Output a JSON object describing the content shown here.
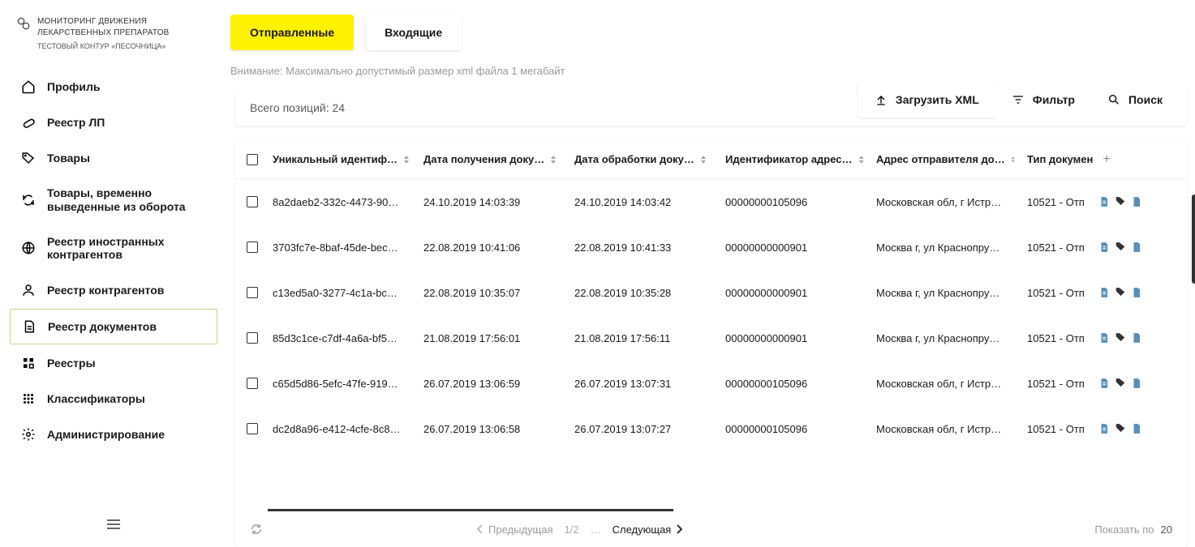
{
  "brand": {
    "title": "МОНИТОРИНГ ДВИЖЕНИЯ ЛЕКАРСТВЕННЫХ ПРЕПАРАТОВ",
    "subtitle": "ТЕСТОВЫЙ КОНТУР «ПЕСОЧНИЦА»"
  },
  "sidebar": {
    "items": [
      {
        "label": "Профиль"
      },
      {
        "label": "Реестр ЛП"
      },
      {
        "label": "Товары"
      },
      {
        "label": "Товары, временно выведенные из оборота"
      },
      {
        "label": "Реестр иностранных контрагентов"
      },
      {
        "label": "Реестр контрагентов"
      },
      {
        "label": "Реестр документов"
      },
      {
        "label": "Реестры"
      },
      {
        "label": "Классификаторы"
      },
      {
        "label": "Администрирование"
      }
    ]
  },
  "tabs": {
    "sent": "Отправленные",
    "incoming": "Входящие"
  },
  "warning": "Внимание: Максимально допустимый размер xml файла 1 мегабайт",
  "total_label": "Всего позиций: 24",
  "toolbar": {
    "upload": "Загрузить XML",
    "filter": "Фильтр",
    "search": "Поиск"
  },
  "columns": {
    "uid": "Уникальный идентиф…",
    "date_received": "Дата получения доку…",
    "date_processed": "Дата обработки доку…",
    "address_id": "Идентификатор адрес…",
    "sender_addr": "Адрес отправителя до…",
    "doc_type": "Тип докумен"
  },
  "rows": [
    {
      "uid": "8a2daeb2-332c-4473-90…",
      "recv": "24.10.2019 14:03:39",
      "proc": "24.10.2019 14:03:42",
      "ident": "00000000105096",
      "addr": "Московская обл, г Истр…",
      "type": "10521 - Отп"
    },
    {
      "uid": "3703fc7e-8baf-45de-bec…",
      "recv": "22.08.2019 10:41:06",
      "proc": "22.08.2019 10:41:33",
      "ident": "00000000000901",
      "addr": "Москва г, ул Краснопру…",
      "type": "10521 - Отп"
    },
    {
      "uid": "c13ed5a0-3277-4c1a-bc…",
      "recv": "22.08.2019 10:35:07",
      "proc": "22.08.2019 10:35:28",
      "ident": "00000000000901",
      "addr": "Москва г, ул Краснопру…",
      "type": "10521 - Отп"
    },
    {
      "uid": "85d3c1ce-c7df-4a6a-bf5…",
      "recv": "21.08.2019 17:56:01",
      "proc": "21.08.2019 17:56:11",
      "ident": "00000000000901",
      "addr": "Москва г, ул Краснопру…",
      "type": "10521 - Отп"
    },
    {
      "uid": "c65d5d86-5efc-47fe-919…",
      "recv": "26.07.2019 13:06:59",
      "proc": "26.07.2019 13:07:31",
      "ident": "00000000105096",
      "addr": "Московская обл, г Истр…",
      "type": "10521 - Отп"
    },
    {
      "uid": "dc2d8a96-e412-4cfe-8c8…",
      "recv": "26.07.2019 13:06:58",
      "proc": "26.07.2019 13:07:27",
      "ident": "00000000105096",
      "addr": "Московская обл, г Истр…",
      "type": "10521 - Отп"
    }
  ],
  "footer": {
    "prev": "Предыдущая",
    "page": "1/2",
    "dots": "…",
    "next": "Следующая",
    "show_by": "Показать по",
    "per_page": "20"
  }
}
